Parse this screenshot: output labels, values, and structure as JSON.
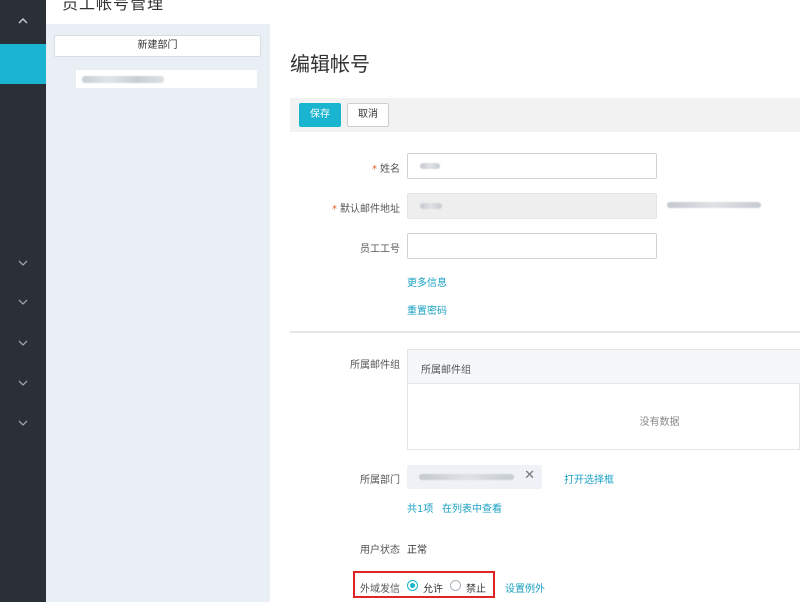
{
  "header": {
    "cropped_title": "员工帐号管理"
  },
  "nav": {
    "active_color": "#19b4cf",
    "chevrons": [
      "chevron-up",
      "chevron-down",
      "chevron-down",
      "chevron-down",
      "chevron-down",
      "chevron-down"
    ]
  },
  "departments": {
    "new_button": "新建部门"
  },
  "form": {
    "title": "编辑帐号",
    "save": "保存",
    "cancel": "取消",
    "required_mark": "*",
    "name_label": "姓名",
    "email_label": "默认邮件地址",
    "employee_id_label": "员工工号",
    "more_info": "更多信息",
    "reset_password": "重置密码",
    "mail_group_label": "所属邮件组",
    "mail_group_header": "所属邮件组",
    "mail_group_empty": "没有数据",
    "department_label": "所属部门",
    "remove_glyph": "✕",
    "open_selector": "打开选择框",
    "dept_count": "共1项",
    "view_in_list": "在列表中查看",
    "user_status_label": "用户状态",
    "user_status_value": "正常",
    "external_mail_label": "外域发信",
    "allow": "允许",
    "forbid": "禁止",
    "set_exceptions": "设置例外"
  }
}
